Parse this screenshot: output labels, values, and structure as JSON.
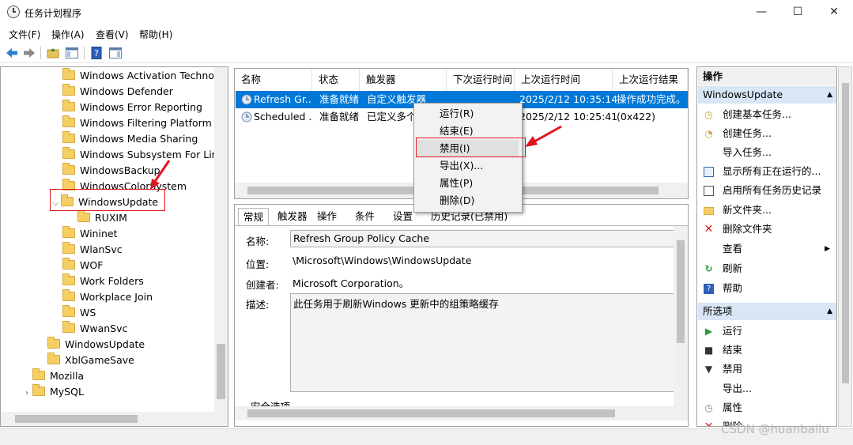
{
  "window": {
    "title": "任务计划程序",
    "icon": "task-scheduler-icon",
    "controls": [
      "—",
      "☐",
      "✕"
    ]
  },
  "menu": [
    "文件(F)",
    "操作(A)",
    "查看(V)",
    "帮助(H)"
  ],
  "tree": {
    "items": [
      {
        "label": "Windows Activation Technolc",
        "level": 2
      },
      {
        "label": "Windows Defender",
        "level": 2
      },
      {
        "label": "Windows Error Reporting",
        "level": 2
      },
      {
        "label": "Windows Filtering Platform",
        "level": 2
      },
      {
        "label": "Windows Media Sharing",
        "level": 2
      },
      {
        "label": "Windows Subsystem For Linu",
        "level": 2
      },
      {
        "label": "WindowsBackup",
        "level": 2
      },
      {
        "label": "WindowsColorSystem",
        "level": 2
      },
      {
        "label": "WindowsUpdate",
        "level": 2,
        "expanded": true,
        "highlighted": true
      },
      {
        "label": "RUXIM",
        "level": 3
      },
      {
        "label": "Wininet",
        "level": 2
      },
      {
        "label": "WlanSvc",
        "level": 2
      },
      {
        "label": "WOF",
        "level": 2
      },
      {
        "label": "Work Folders",
        "level": 2
      },
      {
        "label": "Workplace Join",
        "level": 2
      },
      {
        "label": "WS",
        "level": 2
      },
      {
        "label": "WwanSvc",
        "level": 2
      },
      {
        "label": "WindowsUpdate",
        "level": 1
      },
      {
        "label": "XblGameSave",
        "level": 1
      },
      {
        "label": "Mozilla",
        "level": 0
      },
      {
        "label": "MySQL",
        "level": 0,
        "collapsed": true
      }
    ]
  },
  "tasks": {
    "columns": [
      "名称",
      "状态",
      "触发器",
      "下次运行时间",
      "上次运行时间",
      "上次运行结果"
    ],
    "rows": [
      {
        "name": "Refresh Gr...",
        "status": "准备就绪",
        "trigger": "自定义触发器",
        "next": "",
        "last": "2025/2/12 10:35:14",
        "result": "操作成功完成。",
        "selected": true
      },
      {
        "name": "Scheduled ...",
        "status": "准备就绪",
        "trigger": "已定义多个",
        "next": "",
        "last": "2025/2/12 10:25:41",
        "result": "(0x422)",
        "selected": false
      }
    ]
  },
  "context_menu": {
    "items": [
      "运行(R)",
      "结束(E)",
      "禁用(I)",
      "导出(X)...",
      "属性(P)",
      "删除(D)"
    ],
    "highlighted": "禁用(I)"
  },
  "details": {
    "tabs": [
      "常规",
      "触发器",
      "操作",
      "条件",
      "设置",
      "历史记录(已禁用)"
    ],
    "active_tab": "常规",
    "name_label": "名称:",
    "name_value": "Refresh Group Policy Cache",
    "location_label": "位置:",
    "location_value": "\\Microsoft\\Windows\\WindowsUpdate",
    "author_label": "创建者:",
    "author_value": "Microsoft Corporation。",
    "desc_label": "描述:",
    "desc_value": "此任务用于刷新Windows 更新中的组策略缓存",
    "security_label": "安全选项"
  },
  "actions": {
    "header": "操作",
    "section1": "WindowsUpdate",
    "items1": [
      {
        "icon": "create-basic-task-icon",
        "label": "创建基本任务..."
      },
      {
        "icon": "create-task-icon",
        "label": "创建任务..."
      },
      {
        "icon": "",
        "label": "导入任务..."
      },
      {
        "icon": "running-tasks-icon",
        "label": "显示所有正在运行的..."
      },
      {
        "icon": "history-icon",
        "label": "启用所有任务历史记录"
      },
      {
        "icon": "new-folder-icon",
        "label": "新文件夹..."
      },
      {
        "icon": "delete-folder-icon",
        "label": "删除文件夹"
      },
      {
        "icon": "",
        "label": "查看"
      },
      {
        "icon": "refresh-icon",
        "label": "刷新"
      },
      {
        "icon": "help-icon",
        "label": "帮助"
      }
    ],
    "section2": "所选项",
    "items2": [
      {
        "icon": "run-icon",
        "label": "运行"
      },
      {
        "icon": "end-icon",
        "label": "结束"
      },
      {
        "icon": "disable-icon",
        "label": "禁用"
      },
      {
        "icon": "",
        "label": "导出..."
      },
      {
        "icon": "properties-icon",
        "label": "属性"
      },
      {
        "icon": "delete-icon",
        "label": "删除"
      }
    ]
  },
  "colors": {
    "selection": "#0078d7",
    "annotation": "#e0141e"
  },
  "watermark": "CSDN @huanbailu"
}
